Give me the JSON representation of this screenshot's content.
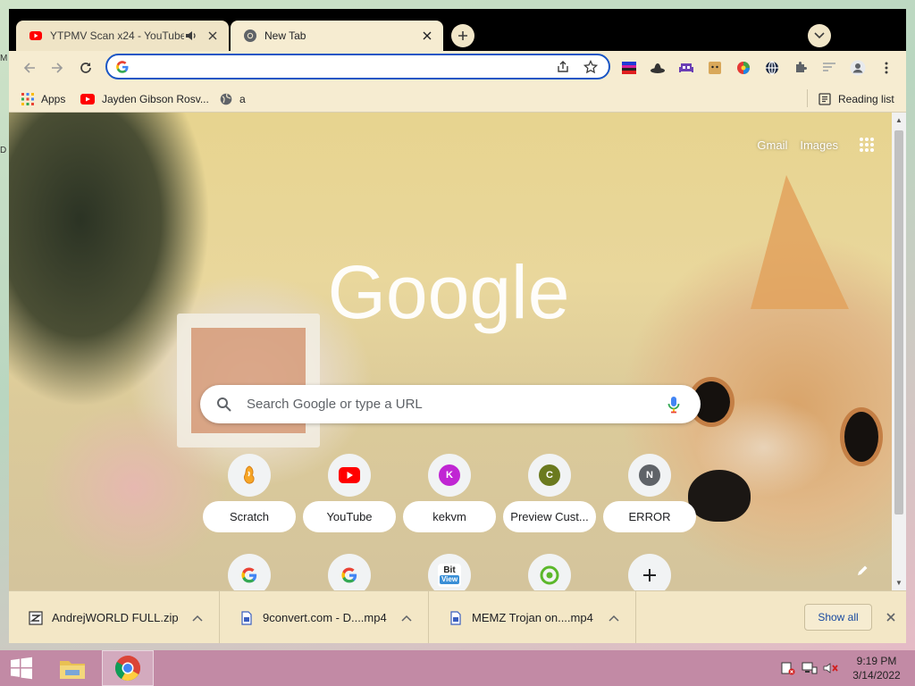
{
  "desktop": {
    "stub_top": "M",
    "stub_mid": "D"
  },
  "tabs": [
    {
      "title": "YTPMV Scan x24 - YouTube",
      "favicon": "youtube-icon",
      "audio": true,
      "active": false
    },
    {
      "title": "New Tab",
      "favicon": "chrome-icon",
      "audio": false,
      "active": true
    }
  ],
  "omnibox": {
    "value": "",
    "placeholder": ""
  },
  "extensions": [
    "extension-1",
    "hat-extension-icon",
    "alien-extension-icon",
    "doge-extension-icon",
    "color-extension-icon",
    "globe-extension-icon",
    "puzzle-icon",
    "reading-queue-icon",
    "profile-icon",
    "more-menu-icon"
  ],
  "bookmarks": {
    "apps_label": "Apps",
    "items": [
      {
        "label": "Jayden Gibson Rosv...",
        "icon": "youtube-icon"
      },
      {
        "label": "a",
        "icon": "globe-icon"
      }
    ],
    "reading_list": "Reading list"
  },
  "ntp": {
    "gmail": "Gmail",
    "images": "Images",
    "search_placeholder": "Search Google or type a URL",
    "logo_text": "Google",
    "shortcuts_row1": [
      {
        "label": "Scratch",
        "icon": "scratch-icon"
      },
      {
        "label": "YouTube",
        "icon": "youtube-icon"
      },
      {
        "label": "kekvm",
        "icon": "K",
        "color": "#c026d3"
      },
      {
        "label": "Preview Cust...",
        "icon": "C",
        "color": "#6b7a1f"
      },
      {
        "label": "ERROR",
        "icon": "N",
        "color": "#5f6368"
      }
    ],
    "shortcuts_row2": [
      {
        "icon": "google-icon"
      },
      {
        "icon": "google-icon"
      },
      {
        "icon": "bitview-icon",
        "text": "Bit View"
      },
      {
        "icon": "green-ring-icon"
      },
      {
        "icon": "add-shortcut-icon"
      }
    ]
  },
  "downloads": {
    "items": [
      {
        "name": "AndrejWORLD FULL.zip",
        "icon": "zip-file-icon"
      },
      {
        "name": "9convert.com - D....mp4",
        "icon": "video-file-icon"
      },
      {
        "name": "MEMZ Trojan on....mp4",
        "icon": "video-file-icon"
      }
    ],
    "show_all": "Show all"
  },
  "taskbar": {
    "apps": [
      "file-explorer-icon",
      "chrome-icon"
    ],
    "clock_time": "9:19 PM",
    "clock_date": "3/14/2022",
    "tray": [
      "action-center-icon",
      "network-icon",
      "volume-muted-icon"
    ]
  },
  "colors": {
    "omnibox_border": "#1a56c5",
    "chrome_bar": "#f6ecd1",
    "taskbar": "#c28aa5",
    "youtube_red": "#ff0000"
  }
}
